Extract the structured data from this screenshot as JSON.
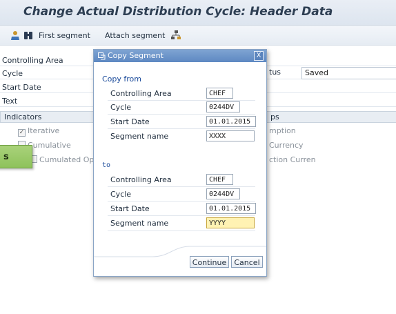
{
  "page": {
    "title": "Change Actual Distribution Cycle: Header Data"
  },
  "toolbar": {
    "first_segment": "First segment",
    "attach_segment": "Attach segment"
  },
  "form": {
    "controlling_area_label": "Controlling Area",
    "cycle_label": "Cycle",
    "start_date_label": "Start Date",
    "text_label": "Text",
    "status_label": "tus",
    "status_value": "Saved"
  },
  "indicators": {
    "header": "Indicators",
    "iterative": "Iterative",
    "cumulative": "Cumulative",
    "cumulated_opt": "Cumulated Opt"
  },
  "groups": {
    "header": "ps",
    "line1": "mption",
    "line2": "Currency",
    "line3": "ction Curren"
  },
  "callout": {
    "text": "s"
  },
  "dialog": {
    "title": "Copy Segment",
    "close": "X",
    "copy_from_label": "Copy from",
    "to_label": "to",
    "from": {
      "controlling_area_label": "Controlling Area",
      "controlling_area": "CHEF",
      "cycle_label": "Cycle",
      "cycle": "0244DV",
      "start_date_label": "Start Date",
      "start_date": "01.01.2015",
      "segment_name_label": "Segment name",
      "segment_name": "XXXX"
    },
    "to": {
      "controlling_area_label": "Controlling Area",
      "controlling_area": "CHEF",
      "cycle_label": "Cycle",
      "cycle": "0244DV",
      "start_date_label": "Start Date",
      "start_date": "01.01.2015",
      "segment_name_label": "Segment name",
      "segment_name": "YYYY"
    },
    "continue_label": "Continue",
    "cancel_label": "Cancel"
  },
  "colors": {
    "title_text": "#2e3f53",
    "dialog_header": "#5d88c2",
    "callout": "#8ec25b",
    "focus_field": "#fff2b3"
  }
}
